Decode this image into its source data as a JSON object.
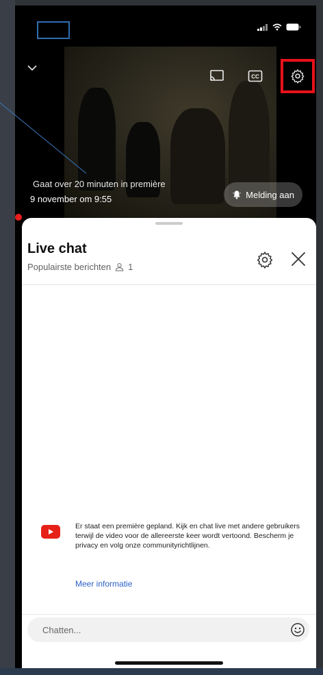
{
  "video": {
    "premiere_text": "Gaat over 20 minuten in première",
    "premiere_date": "9 november om 9:55",
    "melding_label": "Melding aan"
  },
  "icons": {
    "chevron": "chevron-down-icon",
    "cast": "cast-icon",
    "captions": "captions-icon",
    "settings": "gear-icon",
    "bell": "bell-icon",
    "viewer": "person-icon",
    "close": "close-icon",
    "youtube": "youtube-icon",
    "emoji": "emoji-icon"
  },
  "chat": {
    "title": "Live chat",
    "subtitle": "Populairste berichten",
    "viewer_count": "1",
    "info_text": "Er staat een première gepland. Kijk en chat live met andere gebruikers terwijl de video voor de allereerste keer wordt vertoond. Bescherm je privacy en volg onze communityrichtlijnen.",
    "info_link": "Meer informatie",
    "input_placeholder": "Chatten..."
  },
  "colors": {
    "highlight": "#e8111a",
    "youtube_red": "#e62117",
    "link": "#2a61c4",
    "annotation": "#2f6fb0"
  }
}
